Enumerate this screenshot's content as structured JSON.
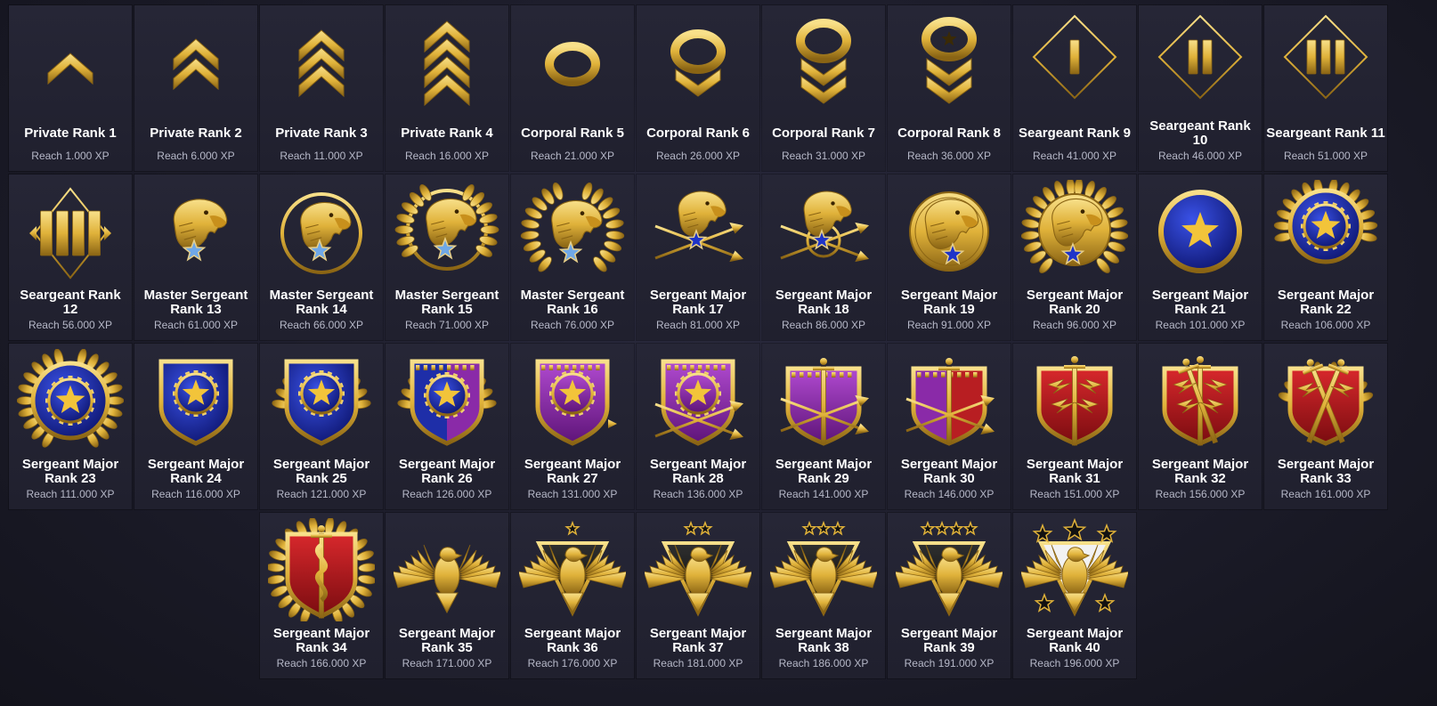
{
  "colors": {
    "gold": "#e0b23a",
    "gold_light": "#f8e08a",
    "gold_dark": "#8a6414",
    "blue": "#1e2ea8",
    "purple": "#8a2aa8",
    "red": "#b81e22",
    "card_bg": "#232332",
    "label": "#ffffff",
    "sublabel": "#b6b8c8"
  },
  "ranks": [
    {
      "name": "Private Rank 1",
      "xp": "Reach 1.000 XP",
      "icon": "chevron-1-icon"
    },
    {
      "name": "Private Rank 2",
      "xp": "Reach 6.000 XP",
      "icon": "chevron-2-icon"
    },
    {
      "name": "Private Rank 3",
      "xp": "Reach 11.000 XP",
      "icon": "chevron-3-icon"
    },
    {
      "name": "Private Rank 4",
      "xp": "Reach 16.000 XP",
      "icon": "chevron-4-icon"
    },
    {
      "name": "Corporal Rank 5",
      "xp": "Reach 21.000 XP",
      "icon": "rocker-chevron-0-icon"
    },
    {
      "name": "Corporal Rank 6",
      "xp": "Reach 26.000 XP",
      "icon": "rocker-chevron-1-icon"
    },
    {
      "name": "Corporal Rank 7",
      "xp": "Reach 31.000 XP",
      "icon": "rocker-chevron-2-icon"
    },
    {
      "name": "Corporal Rank 8",
      "xp": "Reach 36.000 XP",
      "icon": "rocker-chevron-star-icon"
    },
    {
      "name": "Seargeant Rank 9",
      "xp": "Reach 41.000 XP",
      "icon": "diamond-bars-1-icon"
    },
    {
      "name": "Seargeant Rank 10",
      "xp": "Reach 46.000 XP",
      "icon": "diamond-bars-2-icon"
    },
    {
      "name": "Seargeant Rank 11",
      "xp": "Reach 51.000 XP",
      "icon": "diamond-bars-3-icon"
    },
    {
      "name": "Seargeant Rank 12",
      "xp": "Reach 56.000 XP",
      "icon": "diamond-bars-4-icon"
    },
    {
      "name": "Master Sergeant Rank 13",
      "xp": "Reach 61.000 XP",
      "icon": "eagle-star-icon"
    },
    {
      "name": "Master Sergeant Rank 14",
      "xp": "Reach 66.000 XP",
      "icon": "eagle-ring-icon"
    },
    {
      "name": "Master Sergeant Rank 15",
      "xp": "Reach 71.000 XP",
      "icon": "eagle-ring-wreath-icon"
    },
    {
      "name": "Master Sergeant Rank 16",
      "xp": "Reach 76.000 XP",
      "icon": "eagle-laurel-icon"
    },
    {
      "name": "Sergeant Major Rank 17",
      "xp": "Reach 81.000 XP",
      "icon": "eagle-arrows-icon"
    },
    {
      "name": "Sergeant Major Rank 18",
      "xp": "Reach 86.000 XP",
      "icon": "eagle-arrows-wreath-icon"
    },
    {
      "name": "Sergeant Major Rank 19",
      "xp": "Reach 91.000 XP",
      "icon": "eagle-coin-icon"
    },
    {
      "name": "Sergeant Major Rank 20",
      "xp": "Reach 96.000 XP",
      "icon": "eagle-coin-wreath-icon"
    },
    {
      "name": "Sergeant Major Rank 21",
      "xp": "Reach 101.000 XP",
      "icon": "blue-star-medal-icon"
    },
    {
      "name": "Sergeant Major Rank 22",
      "xp": "Reach 106.000 XP",
      "icon": "blue-star-gear-wreath-icon"
    },
    {
      "name": "Sergeant Major Rank 23",
      "xp": "Reach 111.000 XP",
      "icon": "blue-star-gear-laurel-icon"
    },
    {
      "name": "Sergeant Major Rank 24",
      "xp": "Reach 116.000 XP",
      "icon": "blue-shield-icon"
    },
    {
      "name": "Sergeant Major Rank 25",
      "xp": "Reach 121.000 XP",
      "icon": "blue-shield-wreath-icon"
    },
    {
      "name": "Sergeant Major Rank 26",
      "xp": "Reach 126.000 XP",
      "icon": "blue-purple-shield-icon"
    },
    {
      "name": "Sergeant Major Rank 27",
      "xp": "Reach 131.000 XP",
      "icon": "purple-shield-arrow-icon"
    },
    {
      "name": "Sergeant Major Rank 28",
      "xp": "Reach 136.000 XP",
      "icon": "purple-shield-arrows-icon"
    },
    {
      "name": "Sergeant Major Rank 29",
      "xp": "Reach 141.000 XP",
      "icon": "purple-shield-sword-icon"
    },
    {
      "name": "Sergeant Major Rank 30",
      "xp": "Reach 146.000 XP",
      "icon": "purple-red-shield-sword-icon"
    },
    {
      "name": "Sergeant Major Rank 31",
      "xp": "Reach 151.000 XP",
      "icon": "red-shield-sword-bolts-icon"
    },
    {
      "name": "Sergeant Major Rank 32",
      "xp": "Reach 156.000 XP",
      "icon": "red-shield-swords-bolts-icon"
    },
    {
      "name": "Sergeant Major Rank 33",
      "xp": "Reach 161.000 XP",
      "icon": "red-shield-crossed-swords-icon"
    },
    {
      "name": "Sergeant Major Rank 34",
      "xp": "Reach 166.000 XP",
      "icon": "red-shield-serpent-wings-icon"
    },
    {
      "name": "Sergeant Major Rank 35",
      "xp": "Reach 171.000 XP",
      "icon": "spread-eagle-icon"
    },
    {
      "name": "Sergeant Major Rank 36",
      "xp": "Reach 176.000 XP",
      "icon": "eagle-black-shield-1-star-icon"
    },
    {
      "name": "Sergeant Major Rank 37",
      "xp": "Reach 181.000 XP",
      "icon": "eagle-black-shield-2-star-icon"
    },
    {
      "name": "Sergeant Major Rank 38",
      "xp": "Reach 186.000 XP",
      "icon": "eagle-black-shield-3-star-icon"
    },
    {
      "name": "Sergeant Major Rank 39",
      "xp": "Reach 191.000 XP",
      "icon": "eagle-black-shield-4-star-icon"
    },
    {
      "name": "Sergeant Major Rank 40",
      "xp": "Reach 196.000 XP",
      "icon": "eagle-white-shield-5-star-icon"
    }
  ]
}
